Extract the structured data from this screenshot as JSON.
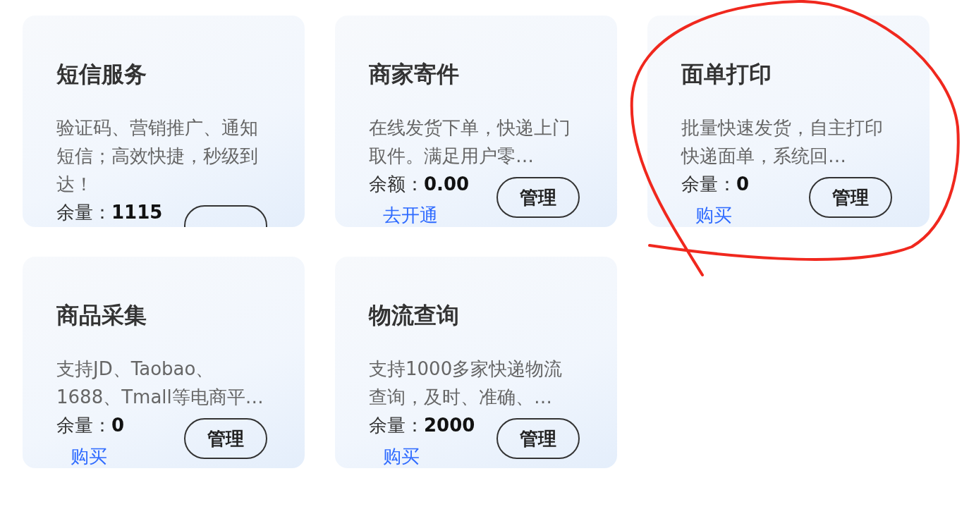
{
  "cards": [
    {
      "title": "短信服务",
      "description": "验证码、营销推广、通知短信；高效快捷，秒级到达！",
      "amount_label": "余量：",
      "amount": "1115",
      "highlighted": false
    },
    {
      "title": "商家寄件",
      "description": "在线发货下单，快递上门取件。满足用户零…",
      "amount_label": "余额：",
      "amount": "0.00",
      "link": "去开通",
      "button": "管理",
      "highlighted": false
    },
    {
      "title": "面单打印",
      "description": "批量快速发货，自主打印快递面单，系统回…",
      "amount_label": "余量：",
      "amount": "0",
      "link": "购买",
      "button": "管理",
      "highlighted": true
    },
    {
      "title": "商品采集",
      "description": "支持JD、Taobao、1688、Tmall等电商平…",
      "amount_label": "余量：",
      "amount": "0",
      "link": "购买",
      "button": "管理",
      "highlighted": false
    },
    {
      "title": "物流查询",
      "description": "支持1000多家快递物流查询，及时、准确、…",
      "amount_label": "余量：",
      "amount": "2000",
      "link": "购买",
      "button": "管理",
      "highlighted": false
    }
  ]
}
